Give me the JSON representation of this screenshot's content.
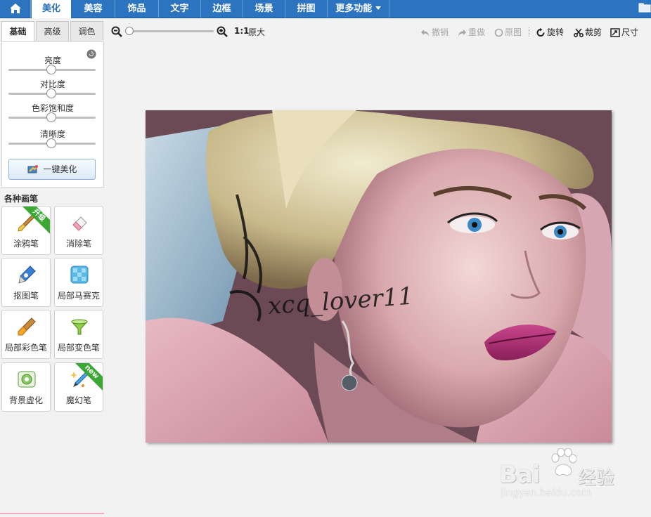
{
  "nav": {
    "items": [
      {
        "label": "美化",
        "active": true
      },
      {
        "label": "美容"
      },
      {
        "label": "饰品"
      },
      {
        "label": "文字"
      },
      {
        "label": "边框"
      },
      {
        "label": "场景"
      },
      {
        "label": "拼图"
      },
      {
        "label": "更多功能"
      }
    ]
  },
  "left": {
    "tabs": [
      "基础",
      "高级",
      "调色"
    ],
    "sliders": [
      {
        "label": "亮度",
        "value": 0.5
      },
      {
        "label": "对比度",
        "value": 0.5
      },
      {
        "label": "色彩饱和度",
        "value": 0.5
      },
      {
        "label": "清晰度",
        "value": 0.5
      }
    ],
    "onekey_label": "一键美化",
    "brush_title": "各种画笔",
    "brushes": [
      {
        "label": "涂鸦笔",
        "icon": "paintbrush-icon",
        "badge": "升级"
      },
      {
        "label": "消除笔",
        "icon": "eraser-icon"
      },
      {
        "label": "抠图笔",
        "icon": "pen-icon"
      },
      {
        "label": "局部马赛克",
        "icon": "mosaic-icon"
      },
      {
        "label": "局部彩色笔",
        "icon": "color-brush-icon"
      },
      {
        "label": "局部变色笔",
        "icon": "color-change-icon"
      },
      {
        "label": "背景虚化",
        "icon": "blur-icon"
      },
      {
        "label": "魔幻笔",
        "icon": "magic-pen-icon",
        "badge": "new"
      }
    ]
  },
  "toolbar": {
    "one_to_one": "1:1",
    "original_size": "原大",
    "undo": "撤销",
    "redo": "重做",
    "original": "原图",
    "rotate": "旋转",
    "crop": "裁剪",
    "size": "尺寸",
    "zoom_level": 0.0
  },
  "photo": {
    "signature": "xcq_lover11"
  },
  "watermark": {
    "brand": "Bai",
    "brand_cn": "经验",
    "url": "jingyan.baidu.com"
  },
  "colors": {
    "nav_blue": "#2c73c0",
    "ribbon_green": "#3aa832"
  }
}
